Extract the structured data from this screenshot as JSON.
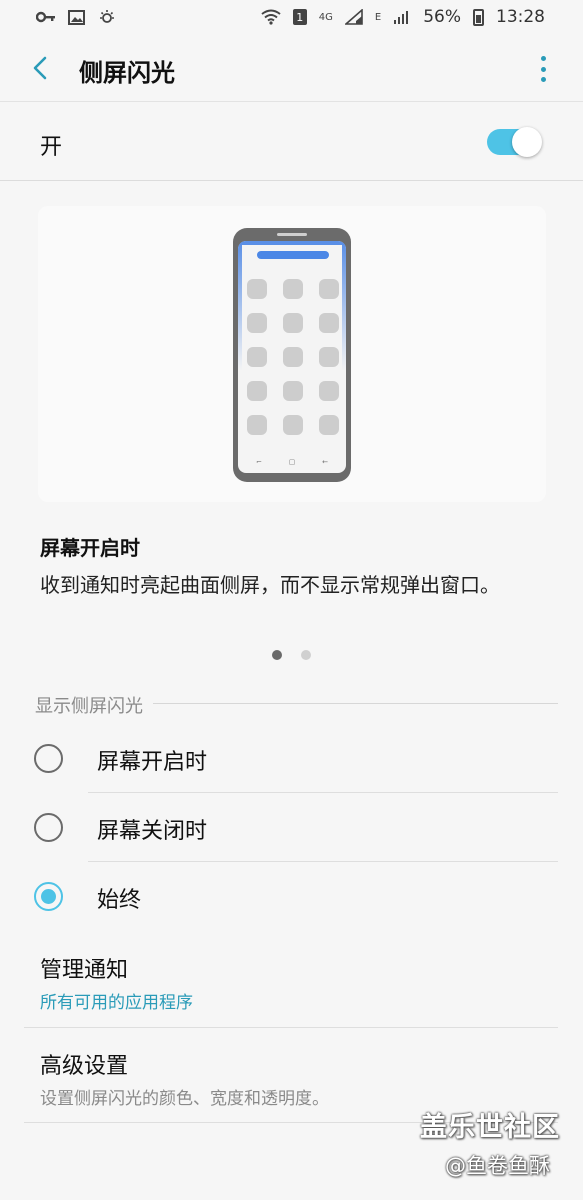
{
  "status_bar": {
    "battery": "56%",
    "time": "13:28",
    "network": "4G",
    "network_secondary": "E",
    "sim_badge": "1"
  },
  "header": {
    "title": "侧屏闪光"
  },
  "master_switch": {
    "label": "开",
    "state": "on"
  },
  "preview": {
    "title": "屏幕开启时",
    "description": "收到通知时亮起曲面侧屏，而不显示常规弹出窗口。",
    "page_count": 2,
    "current_page": 1
  },
  "section": {
    "header": "显示侧屏闪光"
  },
  "options": [
    {
      "label": "屏幕开启时",
      "selected": false
    },
    {
      "label": "屏幕关闭时",
      "selected": false
    },
    {
      "label": "始终",
      "selected": true
    }
  ],
  "list_items": [
    {
      "title": "管理通知",
      "subtitle": "所有可用的应用程序",
      "subtitle_color": "#2a9bb8"
    },
    {
      "title": "高级设置",
      "subtitle": "设置侧屏闪光的颜色、宽度和透明度。",
      "subtitle_color": "#8a8a8a"
    }
  ],
  "watermark": {
    "line1": "盖乐世社区",
    "line2": "@鱼卷鱼酥"
  },
  "colors": {
    "accent": "#4ec3e6",
    "link": "#2a9bb8",
    "edge_light": "#4b87e6"
  }
}
